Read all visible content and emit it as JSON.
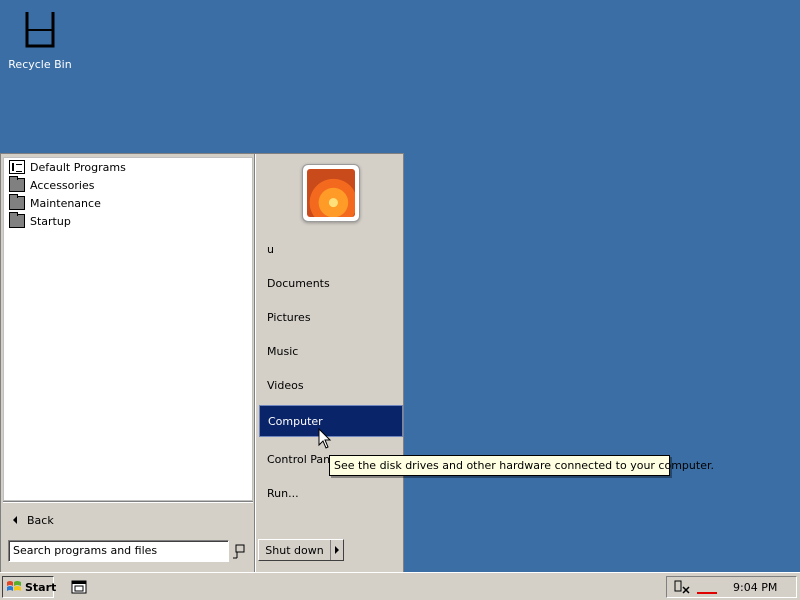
{
  "desktop": {
    "icons": [
      {
        "label": "Recycle Bin",
        "icon": "recycle-bin-icon"
      }
    ]
  },
  "start_menu": {
    "programs": [
      {
        "label": "Default Programs",
        "icon": "default-programs-icon"
      },
      {
        "label": "Accessories",
        "icon": "folder-icon"
      },
      {
        "label": "Maintenance",
        "icon": "folder-icon"
      },
      {
        "label": "Startup",
        "icon": "folder-icon"
      }
    ],
    "back_label": "Back",
    "search_placeholder": "Search programs and files",
    "user_name": "u",
    "right_items": [
      {
        "label": "Documents",
        "selected": false
      },
      {
        "label": "Pictures",
        "selected": false
      },
      {
        "label": "Music",
        "selected": false
      },
      {
        "label": "Videos",
        "selected": false
      },
      {
        "label": "Computer",
        "selected": true
      },
      {
        "label": "Control Panel",
        "selected": false
      },
      {
        "label": "Run...",
        "selected": false
      }
    ],
    "shutdown_label": "Shut down"
  },
  "tooltip": {
    "text": "See the disk drives and other hardware connected to your computer."
  },
  "taskbar": {
    "start_label": "Start",
    "clock": "9:04 PM"
  },
  "colors": {
    "desktop": "#3a6ea5",
    "selection": "#0a246a",
    "tooltip": "#ffffe1",
    "chrome": "#d4d0c8"
  }
}
